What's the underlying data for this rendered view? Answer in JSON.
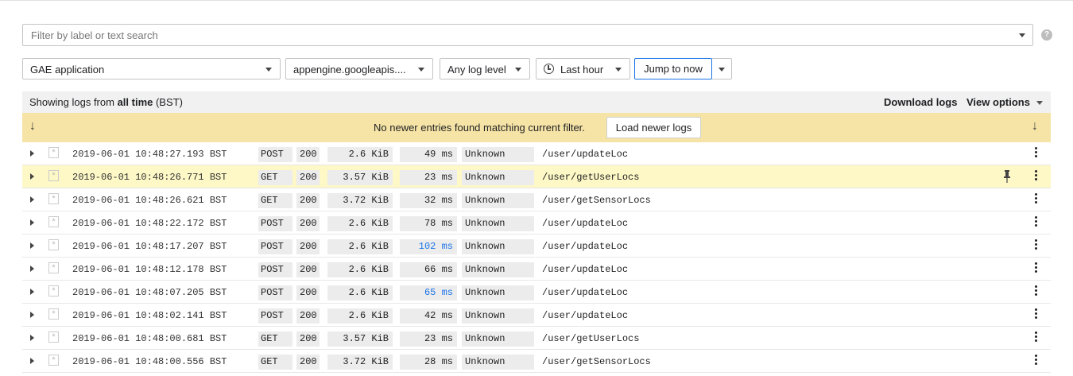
{
  "filter": {
    "placeholder": "Filter by label or text search",
    "dropdown_icon": "chevron-down-icon",
    "help_icon": "help-icon"
  },
  "selectors": {
    "resource": "GAE application",
    "log_name": "appengine.googleapis....",
    "log_level": "Any log level",
    "time_range": "Last hour",
    "jump_button": "Jump to now"
  },
  "info": {
    "showing_prefix": "Showing logs from ",
    "showing_bold": "all time",
    "showing_suffix": " (BST)",
    "download": "Download logs",
    "view_options": "View options"
  },
  "banner": {
    "message": "No newer entries found matching current filter.",
    "load_button": "Load newer logs",
    "bg_color": "#f6e4a6"
  },
  "rows": [
    {
      "timestamp": "2019-06-01 10:48:27.193 BST",
      "method": "POST",
      "status": "200",
      "size": "2.6 KiB",
      "latency": "49 ms",
      "ua": "Unknown",
      "path": "/user/updateLoc"
    },
    {
      "timestamp": "2019-06-01 10:48:26.771 BST",
      "method": "GET",
      "status": "200",
      "size": "3.57 KiB",
      "latency": "23 ms",
      "ua": "Unknown",
      "path": "/user/getUserLocs",
      "highlighted": true
    },
    {
      "timestamp": "2019-06-01 10:48:26.621 BST",
      "method": "GET",
      "status": "200",
      "size": "3.72 KiB",
      "latency": "32 ms",
      "ua": "Unknown",
      "path": "/user/getSensorLocs"
    },
    {
      "timestamp": "2019-06-01 10:48:22.172 BST",
      "method": "POST",
      "status": "200",
      "size": "2.6 KiB",
      "latency": "78 ms",
      "ua": "Unknown",
      "path": "/user/updateLoc"
    },
    {
      "timestamp": "2019-06-01 10:48:17.207 BST",
      "method": "POST",
      "status": "200",
      "size": "2.6 KiB",
      "latency": "102 ms",
      "ua": "Unknown",
      "path": "/user/updateLoc",
      "slow": true
    },
    {
      "timestamp": "2019-06-01 10:48:12.178 BST",
      "method": "POST",
      "status": "200",
      "size": "2.6 KiB",
      "latency": "66 ms",
      "ua": "Unknown",
      "path": "/user/updateLoc"
    },
    {
      "timestamp": "2019-06-01 10:48:07.205 BST",
      "method": "POST",
      "status": "200",
      "size": "2.6 KiB",
      "latency": "65 ms",
      "ua": "Unknown",
      "path": "/user/updateLoc",
      "slow": true
    },
    {
      "timestamp": "2019-06-01 10:48:02.141 BST",
      "method": "POST",
      "status": "200",
      "size": "2.6 KiB",
      "latency": "42 ms",
      "ua": "Unknown",
      "path": "/user/updateLoc"
    },
    {
      "timestamp": "2019-06-01 10:48:00.681 BST",
      "method": "GET",
      "status": "200",
      "size": "3.57 KiB",
      "latency": "23 ms",
      "ua": "Unknown",
      "path": "/user/getUserLocs"
    },
    {
      "timestamp": "2019-06-01 10:48:00.556 BST",
      "method": "GET",
      "status": "200",
      "size": "3.72 KiB",
      "latency": "28 ms",
      "ua": "Unknown",
      "path": "/user/getSensorLocs"
    }
  ],
  "colors": {
    "highlight_row": "#fdf8c6",
    "slow_latency": "#1a73e8",
    "accent": "#1a73e8"
  }
}
